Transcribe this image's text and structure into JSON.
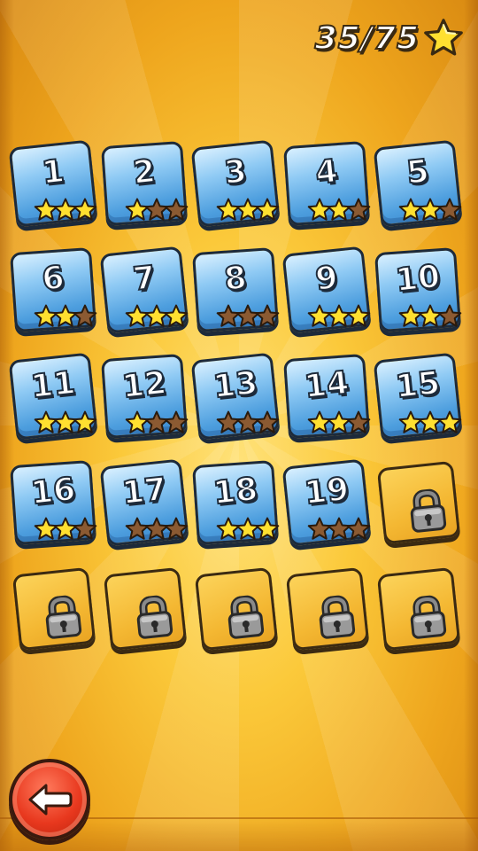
{
  "header": {
    "star_count": "35/75",
    "star_icon": "gold-star-icon"
  },
  "colors": {
    "background": "#fbc93a",
    "tile_blue": "#4d9ede",
    "star_gold": "#ffe030",
    "star_empty": "#8b5a32",
    "back_button": "#e8381e"
  },
  "levels": [
    {
      "label": "1",
      "stars": 3,
      "locked": false
    },
    {
      "label": "2",
      "stars": 1,
      "locked": false
    },
    {
      "label": "3",
      "stars": 3,
      "locked": false
    },
    {
      "label": "4",
      "stars": 2,
      "locked": false
    },
    {
      "label": "5",
      "stars": 2,
      "locked": false
    },
    {
      "label": "6",
      "stars": 2,
      "locked": false
    },
    {
      "label": "7",
      "stars": 3,
      "locked": false
    },
    {
      "label": "8",
      "stars": 0,
      "locked": false
    },
    {
      "label": "9",
      "stars": 3,
      "locked": false
    },
    {
      "label": "10",
      "stars": 2,
      "locked": false
    },
    {
      "label": "11",
      "stars": 3,
      "locked": false
    },
    {
      "label": "12",
      "stars": 1,
      "locked": false
    },
    {
      "label": "13",
      "stars": 0,
      "locked": false
    },
    {
      "label": "14",
      "stars": 2,
      "locked": false
    },
    {
      "label": "15",
      "stars": 3,
      "locked": false
    },
    {
      "label": "16",
      "stars": 2,
      "locked": false
    },
    {
      "label": "17",
      "stars": 0,
      "locked": false
    },
    {
      "label": "18",
      "stars": 3,
      "locked": false
    },
    {
      "label": "19",
      "stars": 0,
      "locked": false
    },
    {
      "label": "",
      "stars": 0,
      "locked": true
    },
    {
      "label": "",
      "stars": 0,
      "locked": true
    },
    {
      "label": "",
      "stars": 0,
      "locked": true
    },
    {
      "label": "",
      "stars": 0,
      "locked": true
    },
    {
      "label": "",
      "stars": 0,
      "locked": true
    },
    {
      "label": "",
      "stars": 0,
      "locked": true
    }
  ],
  "back_button": {
    "icon": "back-arrow-icon"
  }
}
